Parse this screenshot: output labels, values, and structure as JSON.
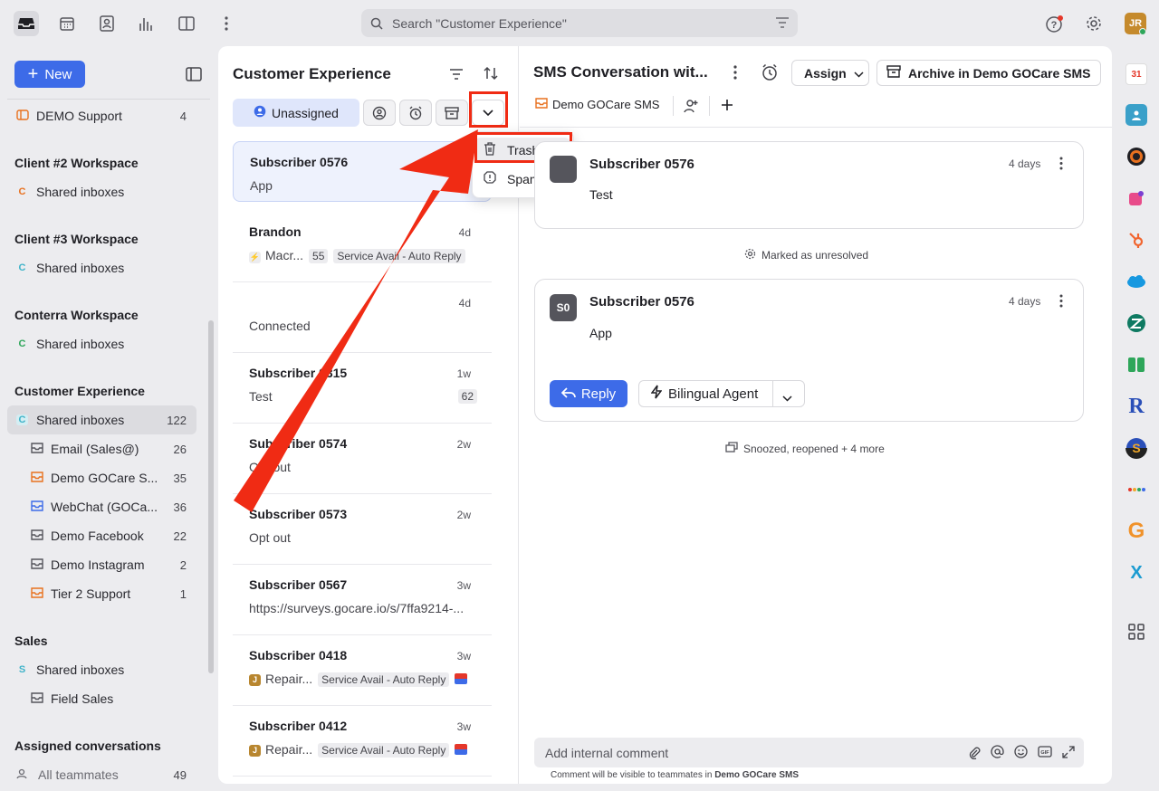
{
  "topbar": {
    "search_placeholder": "Search \"Customer Experience\"",
    "avatar_initials": "JR"
  },
  "sidebar": {
    "new_label": "New",
    "demo_support": {
      "label": "DEMO Support",
      "count": "4"
    },
    "groups": [
      {
        "title": "Client #2 Workspace",
        "badge": "C",
        "badge_color": "#e8711f",
        "item": "Shared inboxes"
      },
      {
        "title": "Client #3 Workspace",
        "badge": "C",
        "badge_color": "#3fb3c9",
        "item": "Shared inboxes"
      },
      {
        "title": "Conterra Workspace",
        "badge": "C",
        "badge_color": "#2ea65a",
        "item": "Shared inboxes"
      },
      {
        "title": "Customer Experience",
        "badge": "C",
        "badge_color": "#3fb3c9",
        "item": "Shared inboxes",
        "count": "122"
      }
    ],
    "inboxes": [
      {
        "label": "Email (Sales@)",
        "count": "26",
        "color": "#55555c"
      },
      {
        "label": "Demo GOCare S...",
        "count": "35",
        "color": "#e8711f"
      },
      {
        "label": "WebChat (GOCa...",
        "count": "36",
        "color": "#3d6be8"
      },
      {
        "label": "Demo Facebook",
        "count": "22",
        "color": "#55555c"
      },
      {
        "label": "Demo Instagram",
        "count": "2",
        "color": "#55555c"
      },
      {
        "label": "Tier 2 Support",
        "count": "1",
        "color": "#e8711f"
      }
    ],
    "sales": {
      "title": "Sales",
      "badge": "S",
      "item": "Shared inboxes",
      "field": "Field Sales"
    },
    "assigned": {
      "title": "Assigned conversations",
      "all": "All teammates",
      "count": "49"
    }
  },
  "list": {
    "title": "Customer Experience",
    "tab_unassigned": "Unassigned",
    "dropdown": {
      "trash": "Trash",
      "spam": "Spam"
    },
    "conversations": [
      {
        "name": "Subscriber 0576",
        "time": "",
        "preview": "App"
      },
      {
        "name": "Brandon",
        "time": "4d",
        "preview": "Macr...",
        "num": "55",
        "tag": "Service Avail - Auto Reply"
      },
      {
        "name": "",
        "time": "4d",
        "preview": "Connected"
      },
      {
        "name": "Subscriber 0315",
        "time": "1w",
        "preview": "Test",
        "num": "62"
      },
      {
        "name": "Subscriber 0574",
        "time": "2w",
        "preview": "Opt out"
      },
      {
        "name": "Subscriber 0573",
        "time": "2w",
        "preview": "Opt out"
      },
      {
        "name": "Subscriber 0567",
        "time": "3w",
        "preview": "https://surveys.gocare.io/s/7ffa9214-..."
      },
      {
        "name": "Subscriber 0418",
        "time": "3w",
        "preview": "Repair...",
        "tag": "Service Avail - Auto Reply"
      },
      {
        "name": "Subscriber 0412",
        "time": "3w",
        "preview": "Repair...",
        "tag": "Service Avail - Auto Reply"
      }
    ]
  },
  "conversation": {
    "title": "SMS Conversation wit...",
    "assign": "Assign",
    "archive": "Archive in Demo GOCare SMS",
    "inbox": "Demo GOCare SMS",
    "msg1": {
      "from": "Subscriber 0576",
      "time": "4 days",
      "body": "Test"
    },
    "event1": "Marked as unresolved",
    "msg2": {
      "from": "Subscriber 0576",
      "avatar": "S0",
      "time": "4 days",
      "body": "App"
    },
    "reply": "Reply",
    "agent": "Bilingual Agent",
    "event2": "Snoozed, reopened + 4 more",
    "comment_placeholder": "Add internal comment",
    "comment_note": "Comment will be visible to teammates in",
    "comment_note_bold": "Demo GOCare SMS"
  },
  "colors": {
    "accent": "#3d6be8",
    "annotation": "#f02b14"
  }
}
